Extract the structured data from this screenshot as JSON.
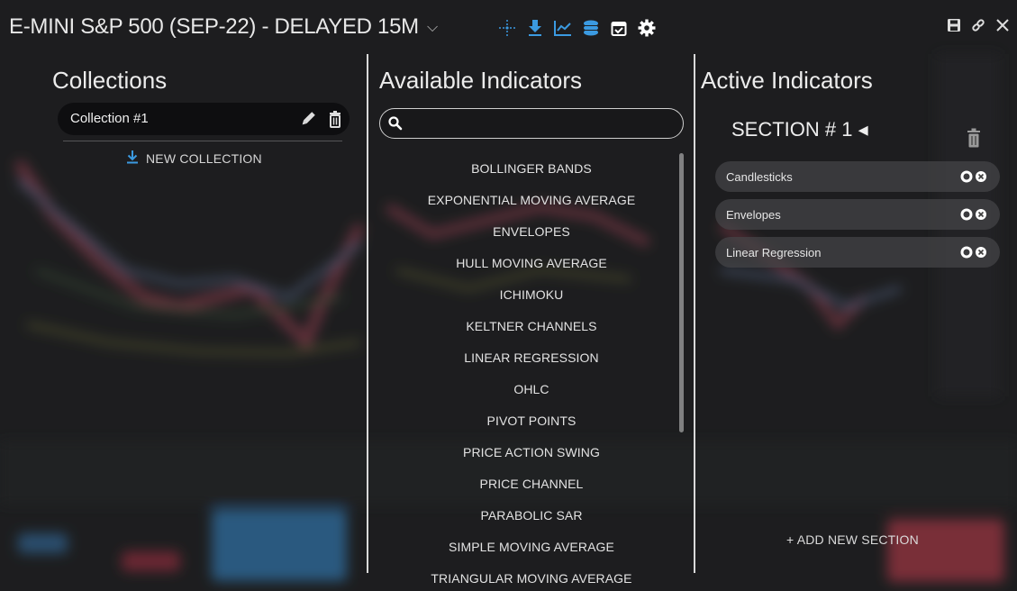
{
  "window": {
    "title": "E-MINI S&P 500 (SEP-22) - DELAYED 15M",
    "title_chevron": "⌵",
    "tool_icons": [
      "crosshair-icon",
      "download-icon",
      "chart-line-icon",
      "layers-icon",
      "calendar-check-icon",
      "gear-icon"
    ],
    "window_icons": [
      "save-icon",
      "link-icon",
      "close-icon"
    ]
  },
  "colors": {
    "accent_blue": "#3b9ae1",
    "background": "#1f2021",
    "divider": "#d9d9d9"
  },
  "collections": {
    "heading": "Collections",
    "items": [
      {
        "name": "Collection #1"
      }
    ],
    "new_label": "NEW COLLECTION"
  },
  "available": {
    "heading": "Available Indicators",
    "search_placeholder": "",
    "items": [
      "BOLLINGER BANDS",
      "EXPONENTIAL MOVING AVERAGE",
      "ENVELOPES",
      "HULL MOVING AVERAGE",
      "ICHIMOKU",
      "KELTNER CHANNELS",
      "LINEAR REGRESSION",
      "OHLC",
      "PIVOT POINTS",
      "PRICE ACTION SWING",
      "PRICE CHANNEL",
      "PARABOLIC SAR",
      "SIMPLE MOVING AVERAGE",
      "TRIANGULAR MOVING AVERAGE"
    ]
  },
  "active": {
    "heading": "Active Indicators",
    "section_title": "SECTION # 1 ◂",
    "items": [
      "Candlesticks",
      "Envelopes",
      "Linear Regression"
    ],
    "add_section_label": "+ ADD NEW SECTION"
  }
}
